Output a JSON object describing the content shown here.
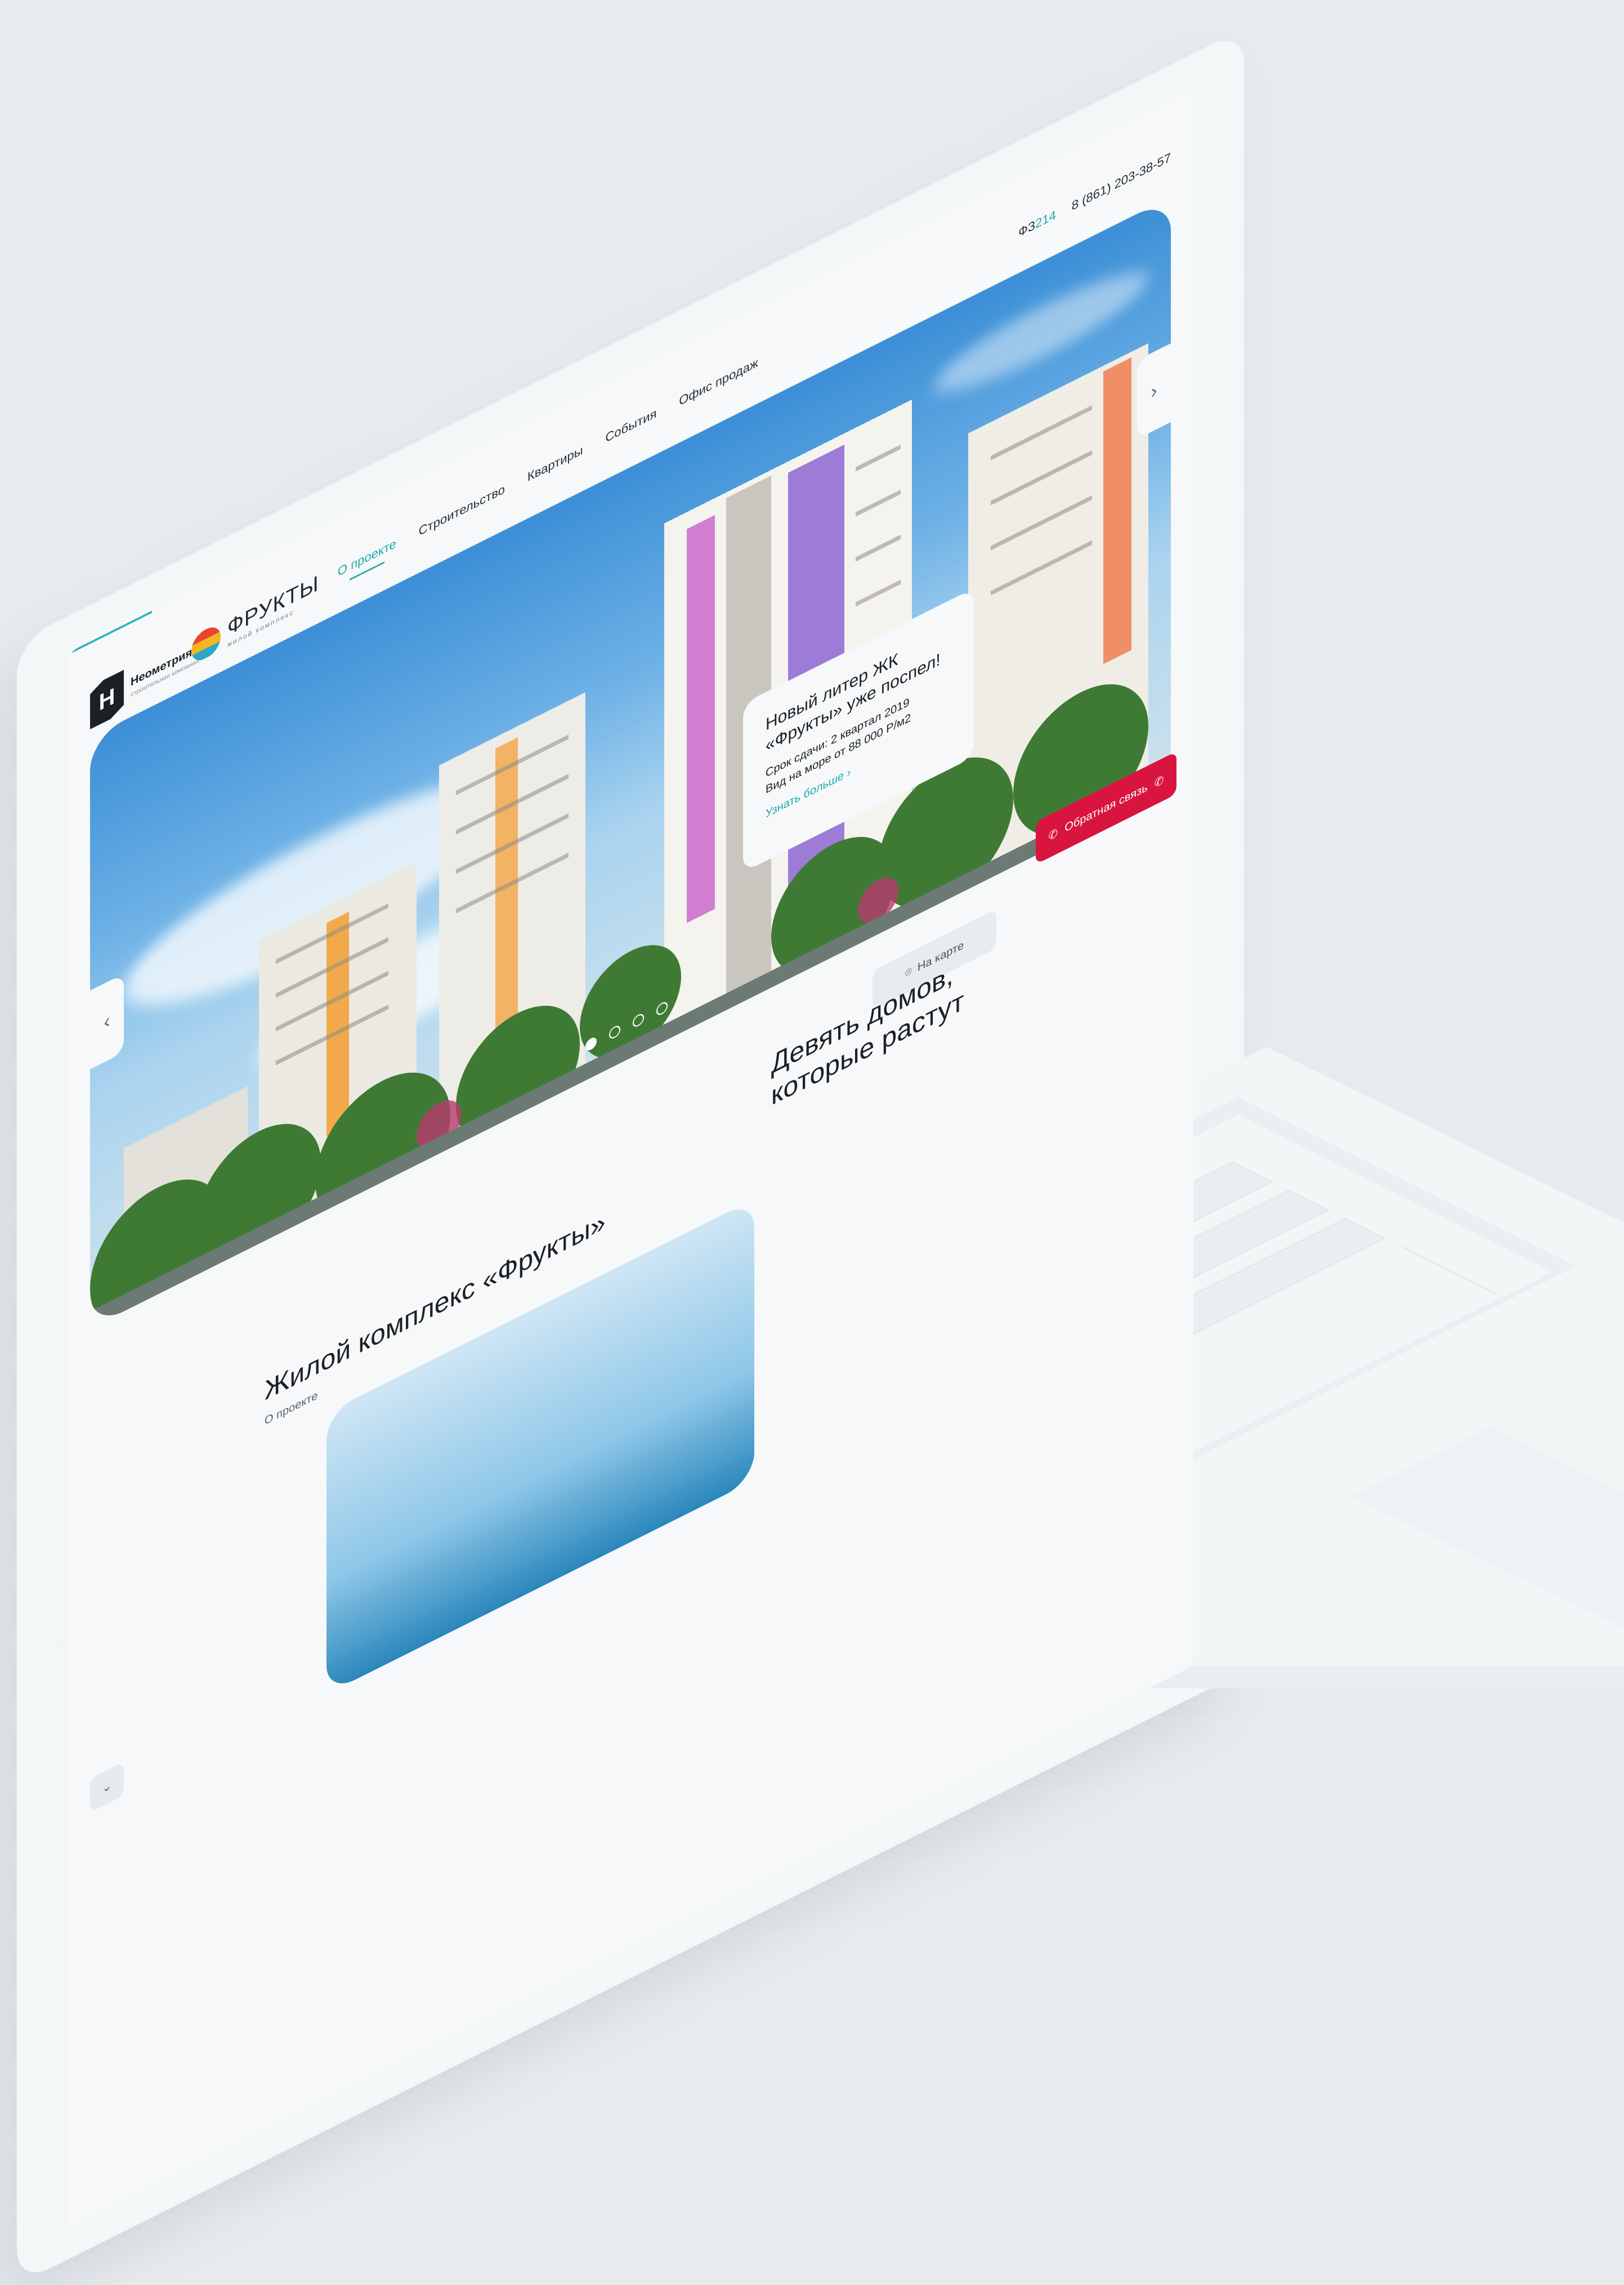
{
  "header": {
    "developer": {
      "logo_letter": "Н",
      "name": "Неометрия",
      "subtitle": "строительная компания"
    },
    "project": {
      "name": "ФРУКТЫ",
      "subtitle": "жилой комплекс"
    },
    "nav": [
      {
        "label": "О проекте",
        "active": true
      },
      {
        "label": "Строительство",
        "active": false
      },
      {
        "label": "Квартиры",
        "active": false
      },
      {
        "label": "События",
        "active": false
      },
      {
        "label": "Офис продаж",
        "active": false
      }
    ],
    "fz_prefix": "ФЗ",
    "fz_number": "214",
    "phone": "8 (861) 203-38-57"
  },
  "hero": {
    "promo": {
      "title": "Новый литер ЖК «Фрукты» уже поспел!",
      "line1": "Срок сдачи: 2 квартал 2019",
      "line2": "Вид на море от 88 000 Р/м2",
      "link": "Узнать больше"
    },
    "slides_count": 4,
    "active_slide": 1
  },
  "buttons": {
    "map": "На карте",
    "callback": "Обратная связь"
  },
  "about": {
    "title": "Жилой комплекс «Фрукты»",
    "subtitle": "О проекте"
  },
  "houses": {
    "title_line1": "Девять домов,",
    "title_line2": "которые растут"
  },
  "colors": {
    "accent": "#21a9ae",
    "callback": "#d9153f",
    "background": "#e7ebee"
  },
  "icons": {
    "prev": "chevron-left-icon",
    "next": "chevron-right-icon",
    "scroll": "chevron-down-icon",
    "map": "map-pin-icon",
    "phone": "phone-icon"
  }
}
